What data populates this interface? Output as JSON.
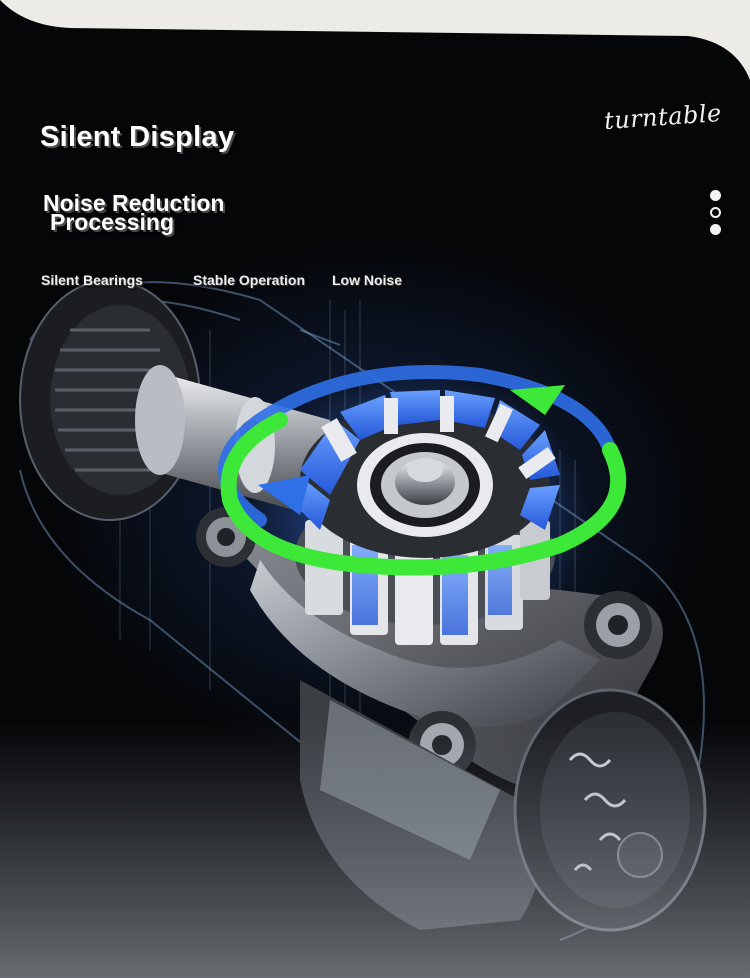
{
  "header": {
    "title": "Silent Display",
    "subtitle_line1": "Noise Reduction",
    "subtitle_line2": "Processing",
    "script_label": "turntable"
  },
  "features": [
    {
      "label": "Silent Bearings"
    },
    {
      "label": "Stable Operation"
    },
    {
      "label": "Low Noise"
    }
  ],
  "pager": {
    "dots": [
      "filled",
      "hollow",
      "filled"
    ]
  },
  "colors": {
    "background": "#050608",
    "cream_corner": "#ecebe6",
    "arrow_green": "#3ee838",
    "arrow_blue": "#2f6fe8",
    "magnet_blue": "#3f7dff"
  }
}
